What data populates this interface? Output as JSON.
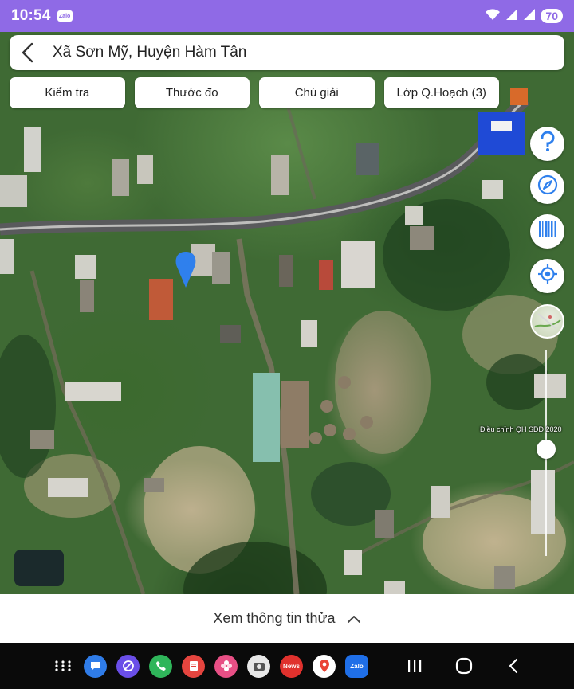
{
  "status_bar": {
    "time": "10:54",
    "notification_app": "Zalo",
    "battery_level": "70",
    "icons": [
      "wifi-icon",
      "signal-icon",
      "signal-icon",
      "battery-icon"
    ]
  },
  "search_bar": {
    "title": "Xã Sơn Mỹ, Huyện Hàm Tân"
  },
  "toolbar": {
    "buttons": [
      {
        "label": "Kiểm tra"
      },
      {
        "label": "Thước đo"
      },
      {
        "label": "Chú giải"
      },
      {
        "label": "Lớp Q.Hoạch (3)"
      }
    ]
  },
  "side_controls": [
    {
      "icon": "help-icon"
    },
    {
      "icon": "compass-icon"
    },
    {
      "icon": "barcode-icon"
    },
    {
      "icon": "locate-icon"
    },
    {
      "icon": "map-layer-icon"
    }
  ],
  "opacity_slider": {
    "label": "Điều chỉnh QH SDD 2020",
    "level": 0.56
  },
  "bottom_sheet": {
    "label": "Xem thông tin thửa"
  },
  "nav_bar": {
    "apps": [
      {
        "name": "apps-grid-icon",
        "color": "#0a0a0a"
      },
      {
        "name": "messages-app-icon",
        "color": "#2f7ce8"
      },
      {
        "name": "browser-app-icon",
        "color": "#6a4ee8"
      },
      {
        "name": "phone-app-icon",
        "color": "#2fb55a"
      },
      {
        "name": "notes-app-icon",
        "color": "#e5453f"
      },
      {
        "name": "gallery-app-icon",
        "color": "#e84f85"
      },
      {
        "name": "camera-app-icon",
        "color": "#e8e8e8"
      },
      {
        "name": "news-app-icon",
        "color": "#e0312d",
        "label": "News"
      },
      {
        "name": "maps-app-icon",
        "color": "#ffffff"
      },
      {
        "name": "zalo-app-icon",
        "color": "#1f6fe8",
        "label": "Zalo"
      }
    ]
  },
  "colors": {
    "status_bar": "#8f6ae6",
    "marker": "#2f80ed",
    "control_icon": "#2f80ed"
  }
}
